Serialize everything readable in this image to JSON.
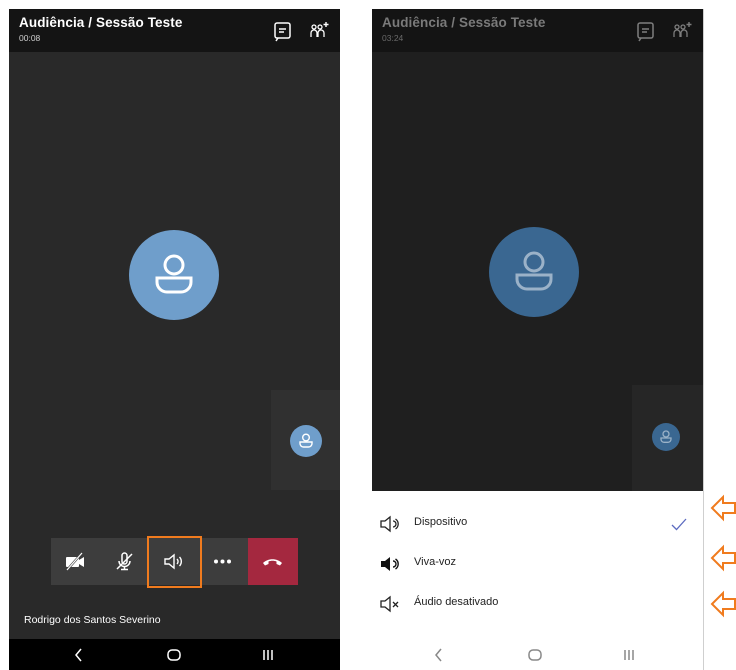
{
  "left_screen": {
    "title": "Audiência / Sessão Teste",
    "timer": "00:08",
    "participant_name": "Rodrigo dos Santos Severino",
    "toolbar": [
      "camera-off",
      "mic-off",
      "speaker",
      "more",
      "end-call"
    ]
  },
  "right_screen": {
    "title": "Audiência / Sessão Teste",
    "timer": "03:24",
    "audio_options": [
      {
        "label": "Dispositivo",
        "icon": "speaker-outline-icon",
        "selected": true
      },
      {
        "label": "Viva-voz",
        "icon": "speaker-filled-icon",
        "selected": false
      },
      {
        "label": "Áudio desativado",
        "icon": "speaker-muted-icon",
        "selected": false
      }
    ]
  },
  "colors": {
    "accent_avatar": "#6f9ecb",
    "end_call": "#a4283f",
    "highlight": "#f07b1e"
  }
}
